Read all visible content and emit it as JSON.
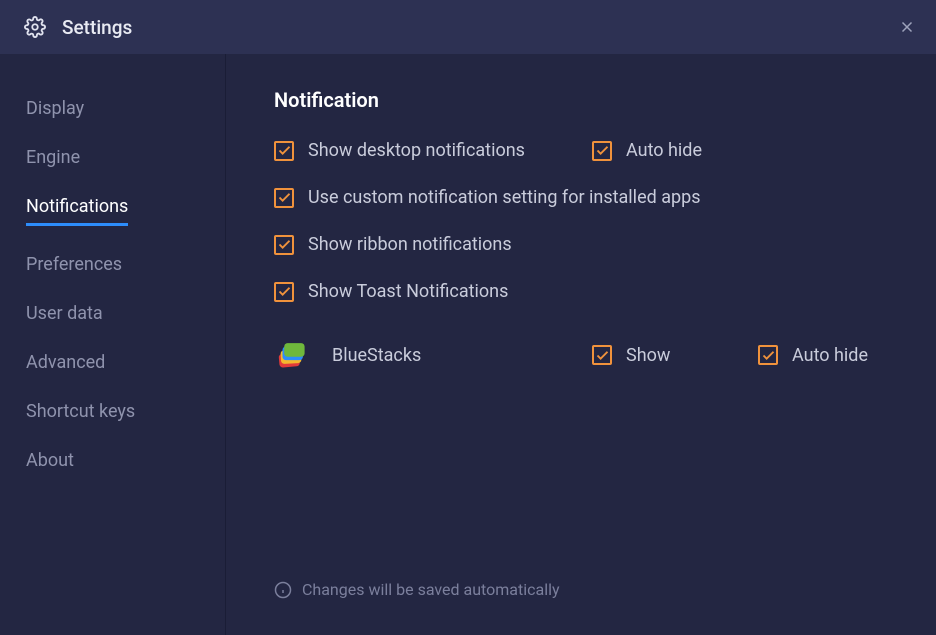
{
  "header": {
    "title": "Settings"
  },
  "sidebar": {
    "items": [
      {
        "label": "Display",
        "active": false
      },
      {
        "label": "Engine",
        "active": false
      },
      {
        "label": "Notifications",
        "active": true
      },
      {
        "label": "Preferences",
        "active": false
      },
      {
        "label": "User data",
        "active": false
      },
      {
        "label": "Advanced",
        "active": false
      },
      {
        "label": "Shortcut keys",
        "active": false
      },
      {
        "label": "About",
        "active": false
      }
    ]
  },
  "main": {
    "section_title": "Notification",
    "checkboxes": {
      "desktop_notifications": "Show desktop notifications",
      "auto_hide": "Auto hide",
      "custom_setting": "Use custom notification setting for installed apps",
      "ribbon_notifications": "Show ribbon notifications",
      "toast_notifications": "Show Toast Notifications"
    },
    "app": {
      "name": "BlueStacks",
      "show_label": "Show",
      "auto_hide_label": "Auto hide"
    },
    "footer": "Changes will be saved automatically"
  }
}
